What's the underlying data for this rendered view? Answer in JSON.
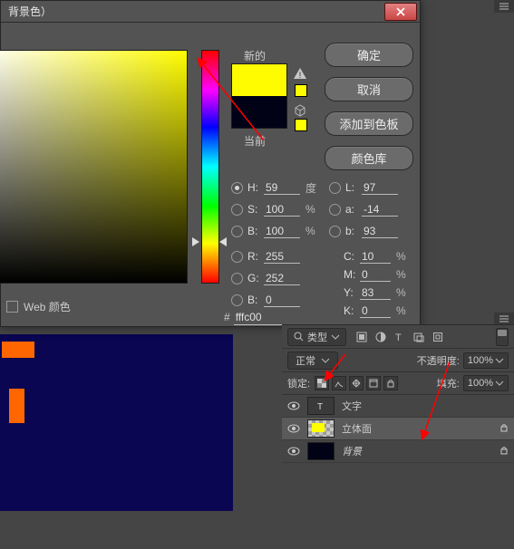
{
  "dialog": {
    "title": "背景色）",
    "buttons": {
      "ok": "确定",
      "cancel": "取消",
      "add_swatch": "添加到色板",
      "color_lib": "颜色库"
    },
    "labels": {
      "new": "新的",
      "current": "当前",
      "webcolor": "Web 颜色"
    },
    "hsb": {
      "h": "59",
      "s": "100",
      "b": "100",
      "unit_deg": "度",
      "unit_pct": "%"
    },
    "rgb": {
      "r": "255",
      "g": "252",
      "b": "0"
    },
    "lab": {
      "l": "97",
      "a": "-14",
      "b": "93"
    },
    "cmyk": {
      "c": "10",
      "m": "0",
      "y": "83",
      "k": "0",
      "unit": "%"
    },
    "hex": "fffc00",
    "field_labels": {
      "H": "H:",
      "S": "S:",
      "B": "B:",
      "R": "R:",
      "G": "G:",
      "Bb": "B:",
      "L": "L:",
      "a": "a:",
      "b": "b:",
      "C": "C:",
      "M": "M:",
      "Y": "Y:",
      "K": "K:"
    },
    "colors": {
      "new_color": "#fffc00",
      "current_color": "#020217"
    }
  },
  "layers": {
    "search_label": "类型",
    "blend_mode": "正常",
    "opacity_label": "不透明度:",
    "opacity_value": "100%",
    "fill_label": "填充:",
    "fill_value": "100%",
    "lock_label": "锁定:",
    "items": [
      {
        "name": "layer-text",
        "label": "文字",
        "thumb": "txt",
        "selected": false,
        "locked": false
      },
      {
        "name": "layer-cube",
        "label": "立体面",
        "thumb": "checker",
        "selected": true,
        "locked": true
      },
      {
        "name": "layer-bg",
        "label": "背景",
        "thumb": "dark",
        "selected": false,
        "locked": true
      }
    ]
  }
}
